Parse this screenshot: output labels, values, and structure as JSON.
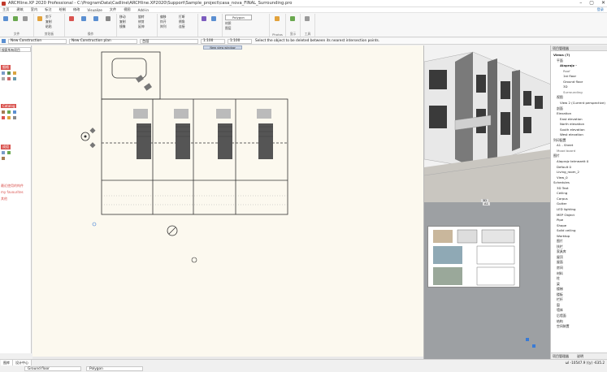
{
  "window": {
    "title": "ARCHline.XP 2020 Professional - C:\\ProgramData\\Cadline\\ARCHline.XP2020\\Support\\Sample_project\\casa_nova_FINAL_Surrounding.pro",
    "login_label": "登录"
  },
  "menu": {
    "items": [
      "主页",
      "建筑",
      "室内",
      "标注",
      "绘制",
      "修改",
      "Visualize",
      "文件",
      "视图",
      "Add-in"
    ]
  },
  "ribbon": {
    "groups": [
      "文件",
      "剪贴板",
      "操作",
      "",
      "",
      "",
      "",
      "",
      "",
      "Photos",
      "显示",
      "工具"
    ],
    "item_labels": [
      "剪下",
      "复制",
      "粘贴",
      "删除",
      "撤销",
      "重做",
      "选择",
      "移动",
      "复制",
      "镜像",
      "旋转",
      "修剪",
      "延伸",
      "偏移",
      "炸开",
      "阵列",
      "打断",
      "倒角",
      "连接",
      "分解",
      "Polygon",
      "材质",
      "图层"
    ]
  },
  "toolbar": {
    "layer_combo": "New Construction",
    "view_combo": "New Construction plan",
    "level_combo": "台层",
    "scale1": "1:100",
    "scale2": "1:100",
    "status_message": "Select the object to be deleted between its nearest intersection points."
  },
  "left_panel": {
    "top_label": "搜索所有项目",
    "headers": [
      "细格",
      "Catalog",
      "成组",
      "最近使用的构件",
      "my favourites",
      "其他"
    ],
    "bottom_tabs": [
      "图库",
      "设计中心"
    ]
  },
  "canvas": {
    "label": "New view window"
  },
  "render": {
    "tab_label": "3D"
  },
  "sheet": {
    "tab_label": "A1"
  },
  "right_panel": {
    "header": "项目管理器",
    "items": [
      {
        "text": "Views (7)",
        "bold": true,
        "indent": 0
      },
      {
        "text": "平面",
        "bold": false,
        "indent": 1
      },
      {
        "text": "Alaprajz - ",
        "bold": true,
        "indent": 2
      },
      {
        "text": "Roof",
        "bold": false,
        "indent": 3,
        "sub": true
      },
      {
        "text": "1st floor",
        "bold": false,
        "indent": 3
      },
      {
        "text": "Ground floor",
        "bold": false,
        "indent": 3
      },
      {
        "text": "3D",
        "bold": false,
        "indent": 3
      },
      {
        "text": "Surrounding",
        "bold": false,
        "indent": 3,
        "sub": true
      },
      {
        "text": "视图",
        "bold": false,
        "indent": 1
      },
      {
        "text": "View 2 (Current perspective)",
        "bold": false,
        "indent": 2
      },
      {
        "text": "剖面",
        "bold": false,
        "indent": 1
      },
      {
        "text": "Elevation",
        "bold": false,
        "indent": 1
      },
      {
        "text": "East elevation",
        "bold": false,
        "indent": 2
      },
      {
        "text": "North elevation",
        "bold": false,
        "indent": 2
      },
      {
        "text": "South elevation",
        "bold": false,
        "indent": 2
      },
      {
        "text": "West elevation",
        "bold": false,
        "indent": 2
      },
      {
        "text": "列印配置",
        "bold": false,
        "indent": 0
      },
      {
        "text": "A1 - Sheet",
        "bold": false,
        "indent": 1
      },
      {
        "text": "Mood board",
        "bold": false,
        "indent": 1,
        "sub": true
      },
      {
        "text": "图片",
        "bold": false,
        "indent": 0
      },
      {
        "text": "Alaprajz telmezett 0",
        "bold": false,
        "indent": 1
      },
      {
        "text": "Default 0",
        "bold": false,
        "indent": 1
      },
      {
        "text": "Living_room_2",
        "bold": false,
        "indent": 1
      },
      {
        "text": "View_0",
        "bold": false,
        "indent": 1
      },
      {
        "text": "Schedules",
        "bold": false,
        "indent": 0
      },
      {
        "text": "3D Text",
        "bold": false,
        "indent": 1
      },
      {
        "text": "Ceiling",
        "bold": false,
        "indent": 1
      },
      {
        "text": "Corpus",
        "bold": false,
        "indent": 1
      },
      {
        "text": "Gutter",
        "bold": false,
        "indent": 1
      },
      {
        "text": "LED lighting",
        "bold": false,
        "indent": 1
      },
      {
        "text": "MEP Object",
        "bold": false,
        "indent": 1
      },
      {
        "text": "Pipe",
        "bold": false,
        "indent": 1
      },
      {
        "text": "Shape",
        "bold": false,
        "indent": 1
      },
      {
        "text": "Solid ceiling",
        "bold": false,
        "indent": 1
      },
      {
        "text": "Worktop",
        "bold": false,
        "indent": 1
      },
      {
        "text": "图片",
        "bold": false,
        "indent": 1
      },
      {
        "text": "扶栏",
        "bold": false,
        "indent": 1
      },
      {
        "text": "家具库",
        "bold": false,
        "indent": 1
      },
      {
        "text": "屋顶",
        "bold": false,
        "indent": 1
      },
      {
        "text": "屋面",
        "bold": false,
        "indent": 1
      },
      {
        "text": "房间",
        "bold": false,
        "indent": 1
      },
      {
        "text": "材料",
        "bold": false,
        "indent": 1
      },
      {
        "text": "柱",
        "bold": false,
        "indent": 1
      },
      {
        "text": "梁",
        "bold": false,
        "indent": 1
      },
      {
        "text": "楼梯",
        "bold": false,
        "indent": 1
      },
      {
        "text": "楼板",
        "bold": false,
        "indent": 1
      },
      {
        "text": "栏杆",
        "bold": false,
        "indent": 1
      },
      {
        "text": "窗",
        "bold": false,
        "indent": 1
      },
      {
        "text": "墙体",
        "bold": false,
        "indent": 1
      },
      {
        "text": "后墙面",
        "bold": false,
        "indent": 1
      },
      {
        "text": "结构",
        "bold": false,
        "indent": 1
      },
      {
        "text": "空间装置",
        "bold": false,
        "indent": 1
      }
    ],
    "bottom_tabs": [
      "项目管理器",
      "说明"
    ]
  },
  "bottombar": {
    "tabs": [
      "图库",
      "设计中心"
    ],
    "level": "Ground floor",
    "mode": "Polygon",
    "coords": "ωl  -10547.9     ((y)  -635.2"
  },
  "colors": {
    "accent": "#2a6fb5",
    "red_header": "#d9534f",
    "canvas_bg": "#fcf9ef"
  }
}
